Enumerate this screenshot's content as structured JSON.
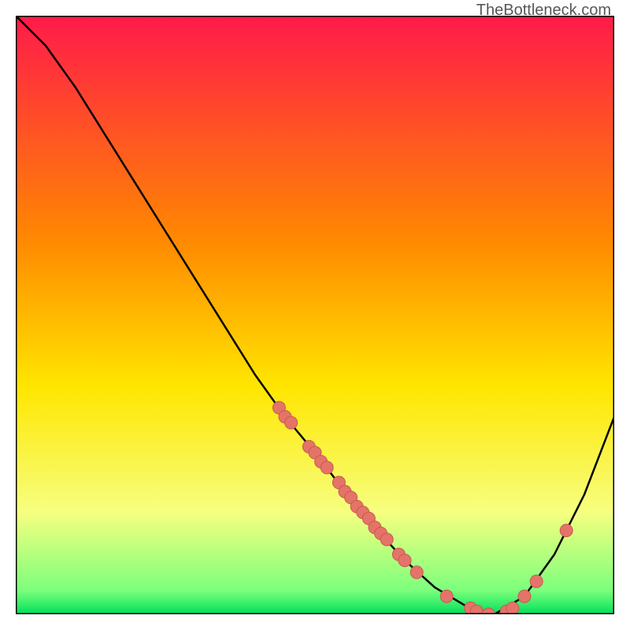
{
  "attribution": "TheBottleneck.com",
  "colors": {
    "gradient_top": "#ff1a4a",
    "gradient_mid1": "#ff7a00",
    "gradient_mid2": "#ffe600",
    "gradient_mid3": "#f4ff6a",
    "gradient_bottom": "#00e05a",
    "curve": "#000000",
    "marker_fill": "#e57368",
    "marker_stroke": "#c45b52",
    "border": "#000000"
  },
  "chart_data": {
    "type": "line",
    "x": [
      0.0,
      0.05,
      0.1,
      0.15,
      0.2,
      0.25,
      0.3,
      0.35,
      0.4,
      0.45,
      0.5,
      0.55,
      0.6,
      0.65,
      0.7,
      0.75,
      0.8,
      0.85,
      0.9,
      0.95,
      1.0
    ],
    "values": [
      1.0,
      0.95,
      0.88,
      0.8,
      0.72,
      0.64,
      0.56,
      0.48,
      0.4,
      0.33,
      0.27,
      0.205,
      0.145,
      0.09,
      0.045,
      0.015,
      0.0,
      0.03,
      0.1,
      0.2,
      0.33
    ],
    "title": "",
    "xlabel": "",
    "ylabel": "",
    "xlim": [
      0,
      1
    ],
    "ylim": [
      0,
      1
    ],
    "markers": [
      {
        "x": 0.44,
        "y": 0.345
      },
      {
        "x": 0.45,
        "y": 0.33
      },
      {
        "x": 0.46,
        "y": 0.32
      },
      {
        "x": 0.49,
        "y": 0.28
      },
      {
        "x": 0.5,
        "y": 0.27
      },
      {
        "x": 0.51,
        "y": 0.255
      },
      {
        "x": 0.52,
        "y": 0.245
      },
      {
        "x": 0.54,
        "y": 0.22
      },
      {
        "x": 0.55,
        "y": 0.205
      },
      {
        "x": 0.56,
        "y": 0.195
      },
      {
        "x": 0.57,
        "y": 0.18
      },
      {
        "x": 0.58,
        "y": 0.17
      },
      {
        "x": 0.59,
        "y": 0.16
      },
      {
        "x": 0.6,
        "y": 0.145
      },
      {
        "x": 0.61,
        "y": 0.135
      },
      {
        "x": 0.62,
        "y": 0.125
      },
      {
        "x": 0.64,
        "y": 0.1
      },
      {
        "x": 0.65,
        "y": 0.09
      },
      {
        "x": 0.67,
        "y": 0.07
      },
      {
        "x": 0.72,
        "y": 0.03
      },
      {
        "x": 0.76,
        "y": 0.01
      },
      {
        "x": 0.77,
        "y": 0.005
      },
      {
        "x": 0.79,
        "y": 0.0
      },
      {
        "x": 0.82,
        "y": 0.005
      },
      {
        "x": 0.83,
        "y": 0.01
      },
      {
        "x": 0.85,
        "y": 0.03
      },
      {
        "x": 0.87,
        "y": 0.055
      },
      {
        "x": 0.92,
        "y": 0.14
      }
    ]
  }
}
